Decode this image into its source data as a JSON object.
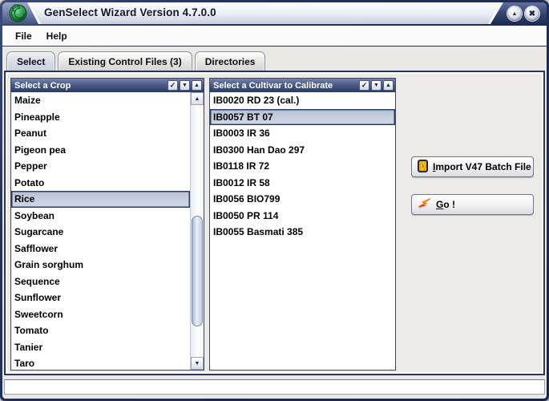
{
  "titlebar": {
    "title": "GenSelect Wizard Version 4.7.0.0"
  },
  "menubar": {
    "items": [
      "File",
      "Help"
    ]
  },
  "tabbar": {
    "tabs": [
      "Select",
      "Existing Control Files (3)",
      "Directories"
    ],
    "active_index": 0
  },
  "crop_panel": {
    "header": "Select a Crop",
    "items": [
      "Maize",
      "Pineapple",
      "Peanut",
      "Pigeon pea",
      "Pepper",
      "Potato",
      "Rice",
      "Soybean",
      "Sugarcane",
      "Safflower",
      "Grain sorghum",
      "Sequence",
      "Sunflower",
      "Sweetcorn",
      "Tomato",
      "Tanier",
      "Taro"
    ],
    "selected_index": 6
  },
  "cultivar_panel": {
    "header": "Select a Cultivar to Calibrate",
    "items": [
      "IB0020 RD 23 (cal.)",
      "IB0057 BT 07",
      "IB0003 IR 36",
      "IB0300 Han Dao 297",
      "IB0118 IR 72",
      "IB0012 IR 58",
      "IB0056 BIO799",
      "IB0050 PR 114",
      "IB0055 Basmati 385"
    ],
    "selected_index": 1
  },
  "actions": {
    "import_button": {
      "mnemonic": "I",
      "rest": "mport V47 Batch File"
    },
    "go_button": {
      "mnemonic": "G",
      "rest": "o !"
    }
  },
  "statusbar": {
    "text": ""
  },
  "icons": {
    "check": "✓",
    "dropdown": "▼",
    "up": "▲",
    "scroll_up": "▲",
    "scroll_down": "▼",
    "minimize": "▲",
    "close": "✖"
  },
  "colors": {
    "window_border_navy": "#22325a",
    "header_gradient_top": "#7484ac",
    "header_gradient_bottom": "#293961",
    "selection_bg": "#c6cfdf",
    "selection_border": "#2c3c64",
    "content_bg": "#eceae7",
    "icon_green": "#2f9e50"
  }
}
